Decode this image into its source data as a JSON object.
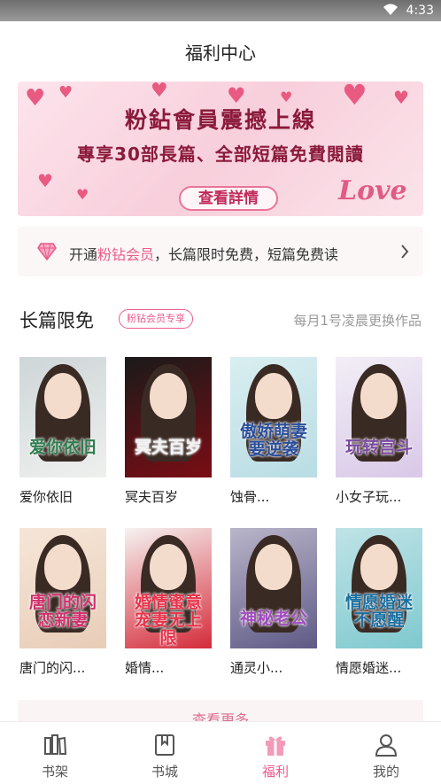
{
  "status": {
    "time": "4:33"
  },
  "page_title": "福利中心",
  "banner": {
    "line1": "粉鉆會員震撼上線",
    "line2": "專享30部長篇、全部短篇免費閱讀",
    "cta": "查看詳情",
    "deco_text": "Love"
  },
  "vip_bar": {
    "prefix": "开通",
    "highlight": "粉钻会员",
    "suffix": "，长篇限时免费，短篇免费读"
  },
  "section": {
    "title": "长篇限免",
    "badge": "粉钻会员专享",
    "note": "每月1号凌晨更换作品"
  },
  "books": [
    {
      "name": "爱你依旧",
      "cover_title": "爱你依旧",
      "colors": [
        "#cfd6d8",
        "#eef0ee"
      ],
      "title_color": "#2e7d4f"
    },
    {
      "name": "冥夫百岁",
      "cover_title": "冥夫百岁",
      "colors": [
        "#1a1a1a",
        "#7a0d14"
      ],
      "title_color": "#f2f2f2"
    },
    {
      "name": "蚀骨...",
      "cover_title": "傲娇萌妻要逆袭",
      "colors": [
        "#d9eef0",
        "#b8dde4"
      ],
      "title_color": "#2a4f9a"
    },
    {
      "name": "小女子玩...",
      "cover_title": "玩转宫斗",
      "colors": [
        "#f2eef6",
        "#d9c8e8"
      ],
      "title_color": "#7a4aa0"
    },
    {
      "name": "唐门的闪...",
      "cover_title": "唐门的闪恋新妻",
      "colors": [
        "#f6e6d8",
        "#e8cdb8"
      ],
      "title_color": "#d0306a"
    },
    {
      "name": "婚情...",
      "cover_title": "婚情蜜意宠妻无上限",
      "colors": [
        "#f6f3f1",
        "#d42b3a"
      ],
      "title_color": "#e8334a"
    },
    {
      "name": "通灵小...",
      "cover_title": "神秘老公",
      "colors": [
        "#b9b5c9",
        "#5f5a86"
      ],
      "title_color": "#a04cc0"
    },
    {
      "name": "情愿婚迷...",
      "cover_title": "情愿婚迷不愿醒",
      "colors": [
        "#bfe3e6",
        "#7fc9cf"
      ],
      "title_color": "#1a6fa0"
    }
  ],
  "more_label": "查看更多",
  "tabs": [
    {
      "label": "书架",
      "icon": "bookshelf-icon"
    },
    {
      "label": "书城",
      "icon": "bookstore-icon"
    },
    {
      "label": "福利",
      "icon": "gift-icon"
    },
    {
      "label": "我的",
      "icon": "profile-icon"
    }
  ],
  "colors": {
    "accent": "#ee5a8b",
    "muted": "#999999"
  }
}
